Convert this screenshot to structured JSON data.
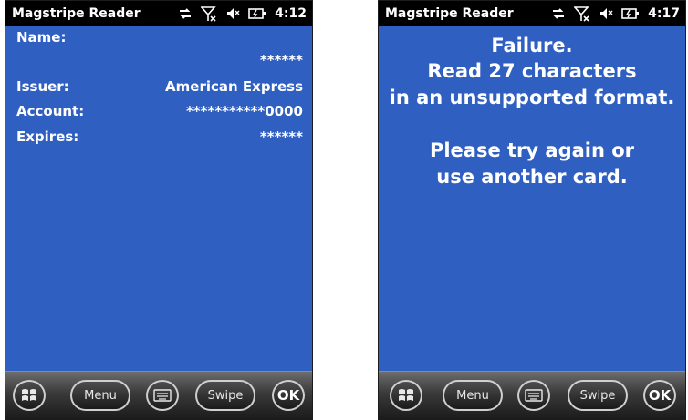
{
  "screens": {
    "left": {
      "app_title": "Magstripe Reader",
      "time": "4:12",
      "fields": {
        "name_label": "Name:",
        "name_value": "******",
        "issuer_label": "Issuer:",
        "issuer_value": "American Express",
        "account_label": "Account:",
        "account_value": "***********0000",
        "expires_label": "Expires:",
        "expires_value": "******"
      },
      "taskbar": {
        "menu_label": "Menu",
        "swipe_label": "Swipe",
        "ok_label": "OK"
      }
    },
    "right": {
      "app_title": "Magstripe Reader",
      "time": "4:17",
      "message_lines": [
        "Failure.",
        "Read 27 characters",
        "in an unsupported format.",
        "Please try again or",
        "use another card."
      ],
      "taskbar": {
        "menu_label": "Menu",
        "swipe_label": "Swipe",
        "ok_label": "OK"
      }
    }
  },
  "colors": {
    "screen_background": "#2f5fc0",
    "status_bar": "#000000",
    "text": "#ffffff"
  },
  "icons": [
    "sync-arrows-icon",
    "no-signal-icon",
    "speaker-muted-icon",
    "battery-charging-icon",
    "windows-start-icon",
    "keyboard-icon"
  ]
}
